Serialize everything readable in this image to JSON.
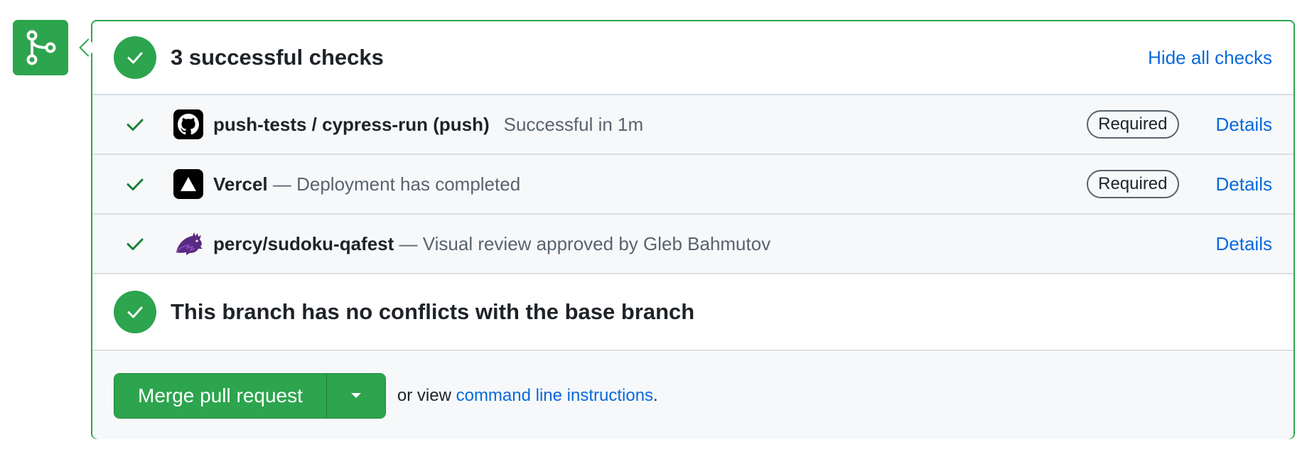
{
  "checks_section": {
    "title": "3 successful checks",
    "hide_label": "Hide all checks"
  },
  "checks": [
    {
      "name": "push-tests / cypress-run (push)",
      "separator": "",
      "description": "Successful in 1m",
      "required": "Required",
      "details": "Details",
      "logo": "github-icon"
    },
    {
      "name": "Vercel",
      "separator": " — ",
      "description": "Deployment has completed",
      "required": "Required",
      "details": "Details",
      "logo": "vercel-icon"
    },
    {
      "name": "percy/sudoku-qafest",
      "separator": " — ",
      "description": "Visual review approved by Gleb Bahmutov",
      "details": "Details",
      "logo": "percy-icon"
    }
  ],
  "conflicts": {
    "title": "This branch has no conflicts with the base branch"
  },
  "merge": {
    "button_label": "Merge pull request",
    "or_text": "or view ",
    "cli_link": "command line instructions",
    "period": "."
  },
  "colors": {
    "success": "#2da44e",
    "link": "#0969da",
    "muted": "#59636e"
  },
  "icons": {
    "branch": "git-branch-icon",
    "check": "check-icon",
    "caret": "caret-down-icon"
  }
}
